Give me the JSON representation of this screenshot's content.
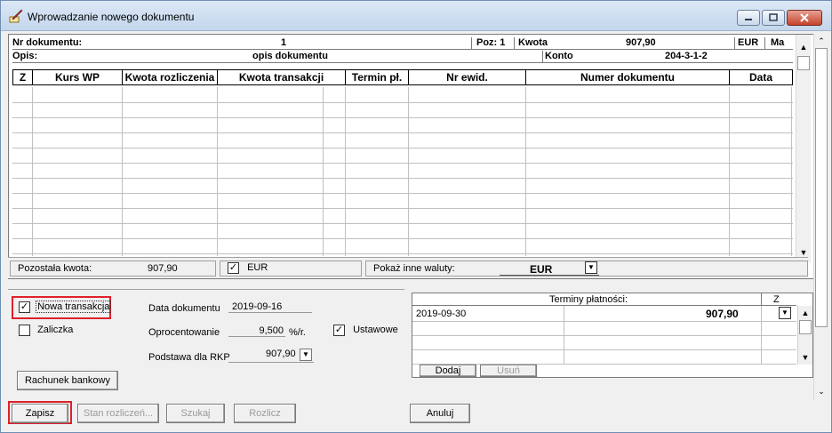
{
  "window": {
    "title": "Wprowadzanie nowego dokumentu"
  },
  "header": {
    "nr_label": "Nr dokumentu:",
    "nr_value": "1",
    "poz_label": "Poz: 1",
    "kwota_label": "Kwota",
    "kwota_value": "907,90",
    "currency": "EUR",
    "ma": "Ma",
    "opis_label": "Opis:",
    "opis_value": "opis dokumentu",
    "konto_label": "Konto",
    "konto_value": "204-3-1-2"
  },
  "grid": {
    "columns": [
      "Z",
      "Kurs WP",
      "Kwota rozliczenia",
      "Kwota transakcji",
      "Termin pł.",
      "Nr ewid.",
      "Numer dokumentu",
      "Data"
    ]
  },
  "status": {
    "remaining_label": "Pozostała kwota:",
    "remaining_value": "907,90",
    "eur_checkbox_label": "EUR",
    "eur_checked": true,
    "other_currencies_label": "Pokaż inne waluty:",
    "other_currency_value": "EUR"
  },
  "form": {
    "new_transaction_label": "Nowa transakcja",
    "new_transaction_checked": true,
    "advance_label": "Zaliczka",
    "advance_checked": false,
    "doc_date_label": "Data dokumentu",
    "doc_date_value": "2019-09-16",
    "interest_label": "Oprocentowanie",
    "interest_value": "9,500",
    "interest_unit": "%/r.",
    "settings_label": "Ustawowe",
    "settings_checked": true,
    "rkp_label": "Podstawa dla RKP",
    "rkp_value": "907,90",
    "bank_account_button": "Rachunek bankowy"
  },
  "terms": {
    "header": "Terminy płatności:",
    "z_header": "Z",
    "rows": [
      {
        "date": "2019-09-30",
        "amount": "907,90"
      }
    ],
    "add_button": "Dodaj",
    "remove_button": "Usuń"
  },
  "footer": {
    "save_button": "Zapisz",
    "settlement_state_button": "Stan rozliczeń...",
    "search_button": "Szukaj",
    "settle_button": "Rozlicz",
    "cancel_button": "Anuluj"
  },
  "colors": {
    "highlight": "#e0202a",
    "title_gradient_top": "#dbe8f7"
  }
}
